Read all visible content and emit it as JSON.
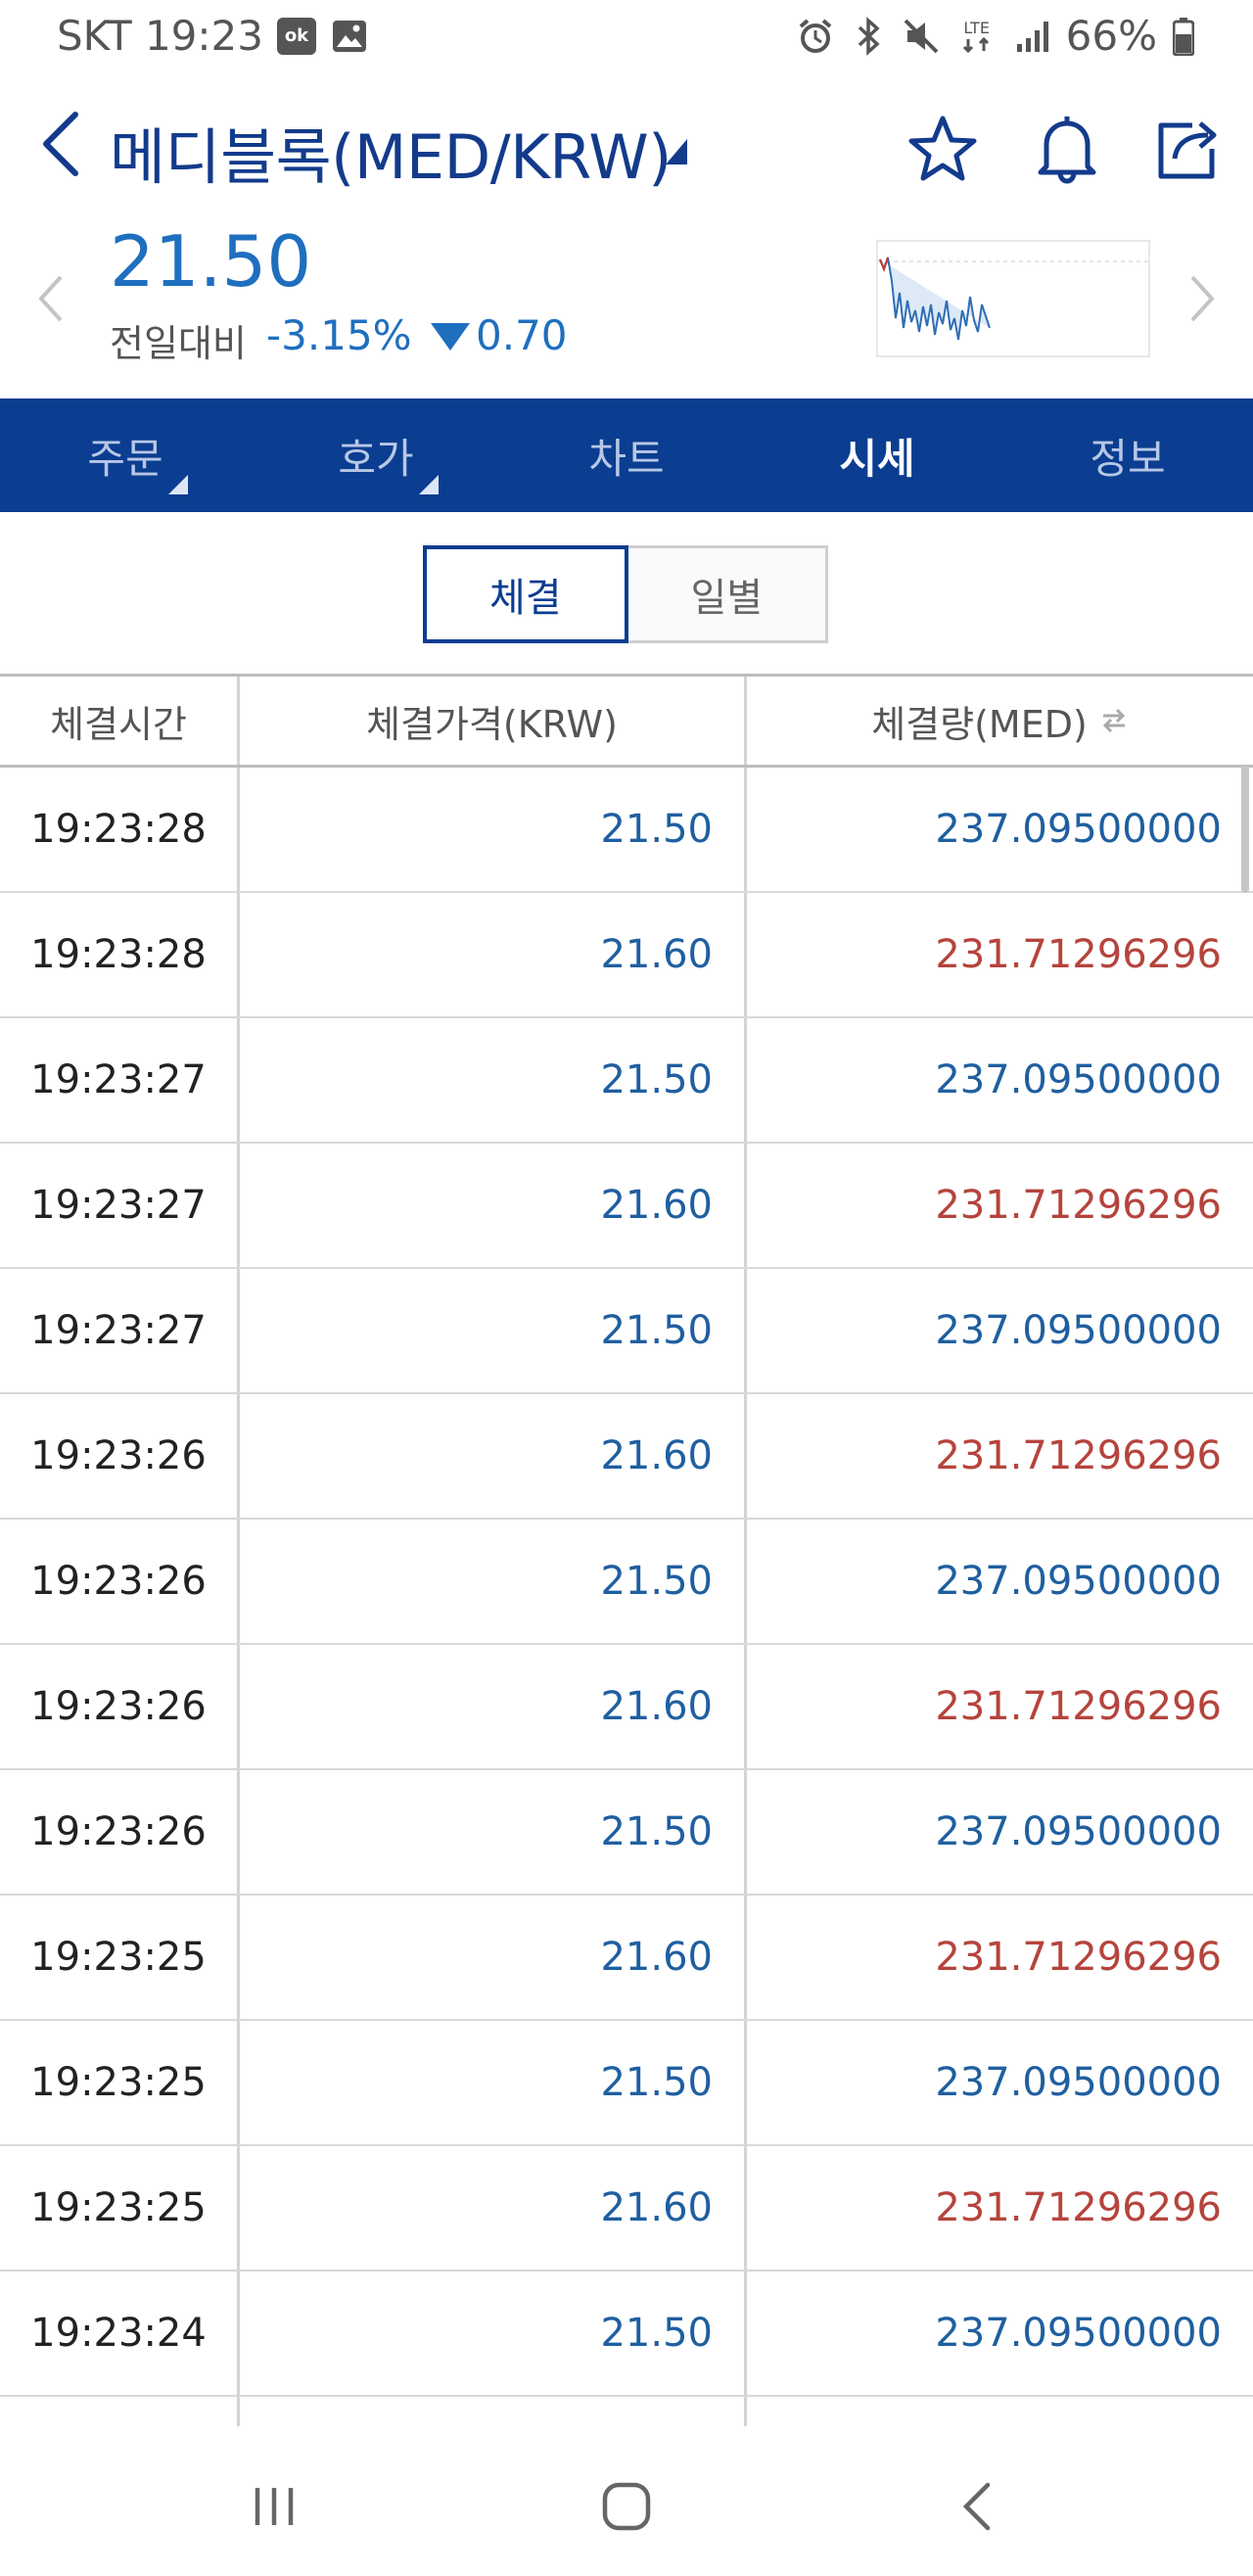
{
  "status_bar": {
    "carrier_time": "SKT 19:23",
    "battery": "66%",
    "network": "LTE",
    "icons": [
      "ok-cashbag-icon",
      "gallery-icon",
      "alarm-icon",
      "bluetooth-icon",
      "mute-icon",
      "lte-icon",
      "signal-icon",
      "battery-icon"
    ]
  },
  "header": {
    "title": "메디블록(MED/KRW)",
    "icons": [
      "back-icon",
      "star-icon",
      "bell-icon",
      "share-icon"
    ]
  },
  "price": {
    "current": "21.50",
    "change_label": "전일대비",
    "change_pct": "-3.15%",
    "change_amount": "0.70",
    "accent_color": "#1f6fbf"
  },
  "tabs": [
    {
      "label": "주문",
      "active": false
    },
    {
      "label": "호가",
      "active": false
    },
    {
      "label": "차트",
      "active": false
    },
    {
      "label": "시세",
      "active": true
    },
    {
      "label": "정보",
      "active": false
    }
  ],
  "segment": {
    "options": [
      "체결",
      "일별"
    ],
    "selected": "체결"
  },
  "table": {
    "headers": [
      "체결시간",
      "체결가격(KRW)",
      "체결량(MED)"
    ],
    "rows": [
      {
        "time": "19:23:28",
        "price": "21.50",
        "qty": "237.09500000",
        "side": "sell"
      },
      {
        "time": "19:23:28",
        "price": "21.60",
        "qty": "231.71296296",
        "side": "buy"
      },
      {
        "time": "19:23:27",
        "price": "21.50",
        "qty": "237.09500000",
        "side": "sell"
      },
      {
        "time": "19:23:27",
        "price": "21.60",
        "qty": "231.71296296",
        "side": "buy"
      },
      {
        "time": "19:23:27",
        "price": "21.50",
        "qty": "237.09500000",
        "side": "sell"
      },
      {
        "time": "19:23:26",
        "price": "21.60",
        "qty": "231.71296296",
        "side": "buy"
      },
      {
        "time": "19:23:26",
        "price": "21.50",
        "qty": "237.09500000",
        "side": "sell"
      },
      {
        "time": "19:23:26",
        "price": "21.60",
        "qty": "231.71296296",
        "side": "buy"
      },
      {
        "time": "19:23:26",
        "price": "21.50",
        "qty": "237.09500000",
        "side": "sell"
      },
      {
        "time": "19:23:25",
        "price": "21.60",
        "qty": "231.71296296",
        "side": "buy"
      },
      {
        "time": "19:23:25",
        "price": "21.50",
        "qty": "237.09500000",
        "side": "sell"
      },
      {
        "time": "19:23:25",
        "price": "21.60",
        "qty": "231.71296296",
        "side": "buy"
      },
      {
        "time": "19:23:24",
        "price": "21.50",
        "qty": "237.09500000",
        "side": "sell"
      }
    ],
    "colors": {
      "sell": "#1f5fa0",
      "buy": "#b5443c"
    }
  },
  "nav": {
    "icons": [
      "recent-apps-icon",
      "home-icon",
      "back-icon"
    ]
  }
}
